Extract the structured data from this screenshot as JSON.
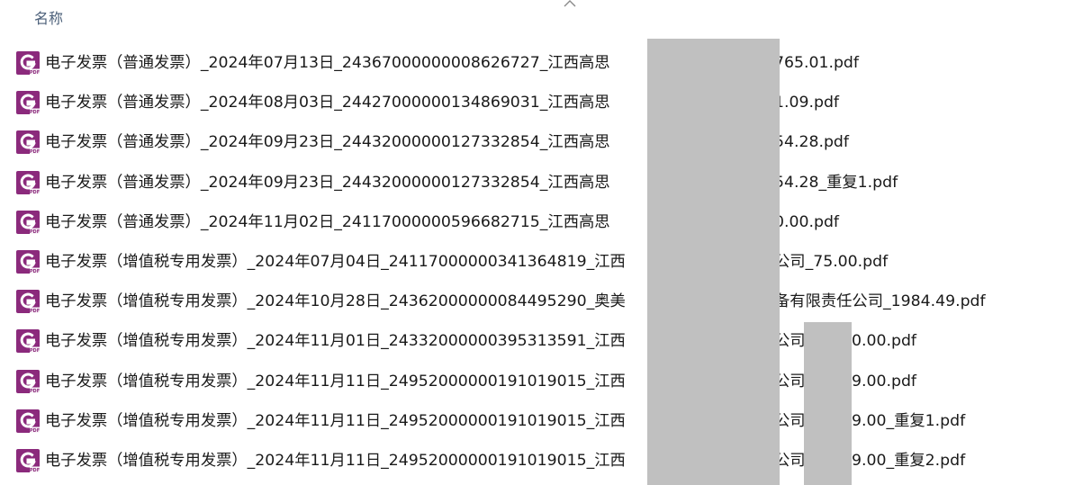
{
  "header": {
    "name_column": "名称",
    "sort_icon": "chevron-up-icon"
  },
  "file_icon": "pdf-icon",
  "colors": {
    "icon_purple": "#8b2a7c",
    "header_text": "#4c607a",
    "redaction": "#c0c0c0"
  },
  "files": [
    {
      "name": "电子发票（普通发票）_2024年07月13日_24367000000008626727_江西高思",
      "suffix": "765.01.pdf"
    },
    {
      "name": "电子发票（普通发票）_2024年08月03日_24427000000134869031_江西高思",
      "suffix": "1.09.pdf"
    },
    {
      "name": "电子发票（普通发票）_2024年09月23日_24432000000127332854_江西高思",
      "suffix": "54.28.pdf"
    },
    {
      "name": "电子发票（普通发票）_2024年09月23日_24432000000127332854_江西高思",
      "suffix": "54.28_重复1.pdf"
    },
    {
      "name": "电子发票（普通发票）_2024年11月02日_24117000000596682715_江西高思",
      "suffix": "0.00.pdf"
    },
    {
      "name": "电子发票（增值税专用发票）_2024年07月04日_24117000000341364819_江西",
      "suffix": "公司_75.00.pdf"
    },
    {
      "name": "电子发票（增值税专用发票）_2024年10月28日_24362000000084495290_奥美",
      "suffix": "备有限责任公司_1984.49.pdf"
    },
    {
      "name": "电子发票（增值税专用发票）_2024年11月01日_24332000000395313591_江西",
      "suffix": "公司",
      "suffix2": "0.00.pdf"
    },
    {
      "name": "电子发票（增值税专用发票）_2024年11月11日_24952000000191019015_江西",
      "suffix": "公司",
      "suffix2": "9.00.pdf"
    },
    {
      "name": "电子发票（增值税专用发票）_2024年11月11日_24952000000191019015_江西",
      "suffix": "公司",
      "suffix2": "9.00_重复1.pdf"
    },
    {
      "name": "电子发票（增值税专用发票）_2024年11月11日_24952000000191019015_江西",
      "suffix": "公司",
      "suffix2": "9.00_重复2.pdf"
    }
  ]
}
